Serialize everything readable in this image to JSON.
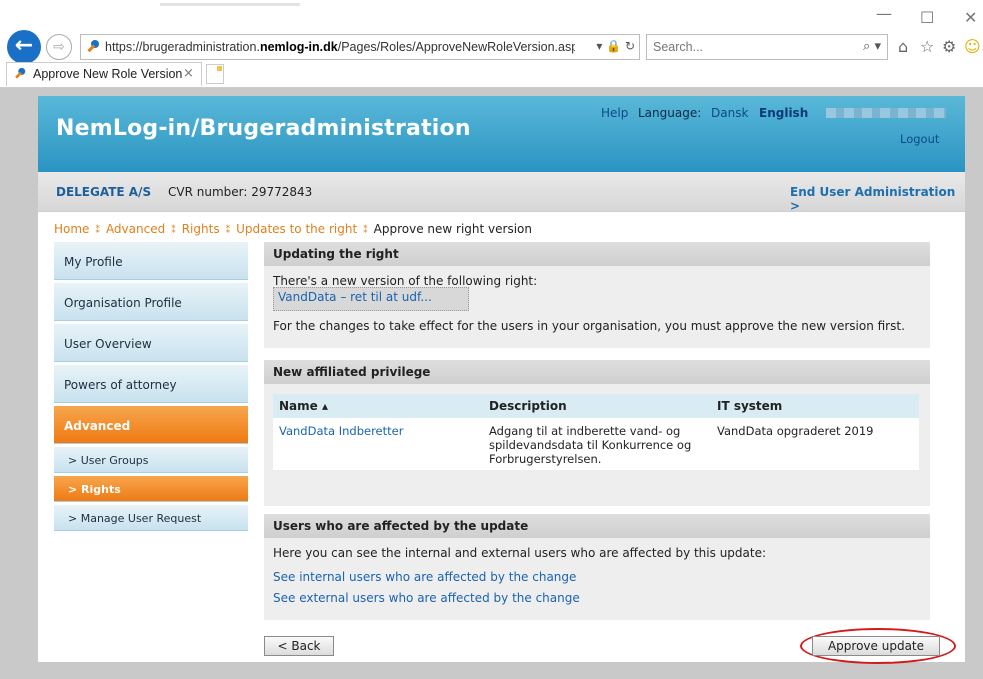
{
  "browser": {
    "url_prefix": "https://brugeradministration.",
    "url_domain": "nemlog-in.dk",
    "url_path": "/Pages/Roles/ApproveNewRoleVersion.aspx?VUSN",
    "address_tools": "▾ 🔒 ↻",
    "search_placeholder": "Search...",
    "tab_title": "Approve New Role Version",
    "tab_close": "×"
  },
  "header": {
    "title": "NemLog-in/Brugeradministration",
    "help": "Help",
    "language_label": "Language:",
    "lang_dansk": "Dansk",
    "lang_english": "English",
    "logout": "Logout"
  },
  "org": {
    "name": "DELEGATE A/S",
    "cvr": "CVR number: 29772843",
    "end_user_admin": "End User Administration >"
  },
  "breadcrumb": {
    "home": "Home",
    "advanced": "Advanced",
    "rights": "Rights",
    "updates": "Updates to the right",
    "current": "Approve new right version"
  },
  "sidebar": {
    "items": [
      {
        "label": "My Profile"
      },
      {
        "label": "Organisation Profile"
      },
      {
        "label": "User Overview"
      },
      {
        "label": "Powers of attorney"
      },
      {
        "label": "Advanced"
      }
    ],
    "sub_items": [
      {
        "label": "> User Groups"
      },
      {
        "label": "> Rights"
      },
      {
        "label": "> Manage User Request"
      }
    ]
  },
  "updating": {
    "heading": "Updating the right",
    "intro": "There's a new version of the following right:",
    "right_link": "VandData – ret til at udf...",
    "note": "For the changes to take effect for the users in your organisation, you must approve the new version first."
  },
  "privilege": {
    "heading": "New affiliated privilege",
    "columns": {
      "name": "Name ▴",
      "description": "Description",
      "it_system": "IT system"
    },
    "row": {
      "name": "VandData Indberetter",
      "description": "Adgang til at indberette vand- og spildevandsdata til Konkurrence og Forbrugerstyrelsen.",
      "it_system": "VandData opgraderet 2019"
    }
  },
  "affected": {
    "heading": "Users who are affected by the update",
    "intro": "Here you can see the internal and external users who are affected by this update:",
    "internal_link": "See internal users who are affected by the change",
    "external_link": "See external users who are affected by the change"
  },
  "actions": {
    "back": "< Back",
    "approve": "Approve update"
  },
  "colors": {
    "header_blue": "#2a94c2",
    "active_orange": "#ef7a12",
    "link_blue": "#1a63b0",
    "highlight_red": "#d21a1a"
  }
}
